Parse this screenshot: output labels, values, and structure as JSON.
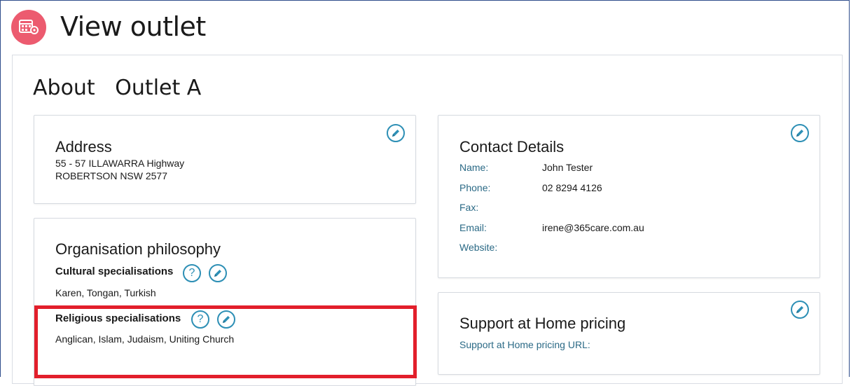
{
  "header": {
    "title": "View outlet",
    "icon": "calendar-gear-icon",
    "icon_color": "#ec5b6f"
  },
  "about": {
    "prefix": "About",
    "outlet_name": "Outlet A",
    "display": "About   Outlet A"
  },
  "address": {
    "title": "Address",
    "line1": "55 - 57 ILLAWARRA Highway",
    "line2": "ROBERTSON NSW 2577"
  },
  "philosophy": {
    "title": "Organisation philosophy",
    "cultural_label": "Cultural specialisations",
    "cultural_values": "Karen, Tongan, Turkish",
    "religious_label": "Religious specialisations",
    "religious_values": "Anglican, Islam, Judaism, Uniting Church",
    "help_glyph": "?"
  },
  "contact": {
    "title": "Contact Details",
    "name_label": "Name:",
    "name_value": "John Tester",
    "phone_label": "Phone:",
    "phone_value": "02 8294 4126",
    "fax_label": "Fax:",
    "fax_value": "",
    "email_label": "Email:",
    "email_value": "irene@365care.com.au",
    "website_label": "Website:",
    "website_value": ""
  },
  "pricing": {
    "title": "Support at Home pricing",
    "url_label": "Support at Home pricing URL:"
  },
  "colors": {
    "accent": "#2d8fb5",
    "label": "#2b6a86",
    "highlight": "#e21f2b"
  }
}
